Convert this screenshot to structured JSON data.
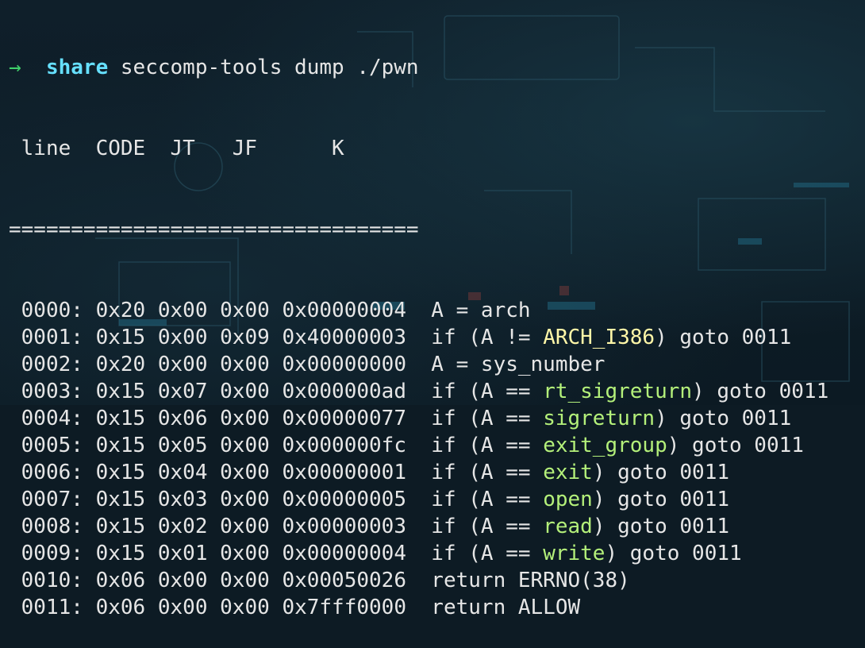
{
  "prompt": {
    "arrow": "→",
    "directory": "share",
    "command": "seccomp-tools dump ./pwn"
  },
  "header": {
    "text": " line  CODE  JT   JF      K"
  },
  "separator": "=================================",
  "rows": [
    {
      "line": "0000:",
      "code": "0x20",
      "jt": "0x00",
      "jf": "0x00",
      "k": "0x00000004",
      "pre": "A = arch",
      "name": "",
      "post": ""
    },
    {
      "line": "0001:",
      "code": "0x15",
      "jt": "0x00",
      "jf": "0x09",
      "k": "0x40000003",
      "pre": "if (A != ",
      "name": "ARCH_I386",
      "post": ") goto 0011",
      "name_kind": "arch"
    },
    {
      "line": "0002:",
      "code": "0x20",
      "jt": "0x00",
      "jf": "0x00",
      "k": "0x00000000",
      "pre": "A = sys_number",
      "name": "",
      "post": ""
    },
    {
      "line": "0003:",
      "code": "0x15",
      "jt": "0x07",
      "jf": "0x00",
      "k": "0x000000ad",
      "pre": "if (A == ",
      "name": "rt_sigreturn",
      "post": ") goto 0011"
    },
    {
      "line": "0004:",
      "code": "0x15",
      "jt": "0x06",
      "jf": "0x00",
      "k": "0x00000077",
      "pre": "if (A == ",
      "name": "sigreturn",
      "post": ") goto 0011"
    },
    {
      "line": "0005:",
      "code": "0x15",
      "jt": "0x05",
      "jf": "0x00",
      "k": "0x000000fc",
      "pre": "if (A == ",
      "name": "exit_group",
      "post": ") goto 0011"
    },
    {
      "line": "0006:",
      "code": "0x15",
      "jt": "0x04",
      "jf": "0x00",
      "k": "0x00000001",
      "pre": "if (A == ",
      "name": "exit",
      "post": ") goto 0011"
    },
    {
      "line": "0007:",
      "code": "0x15",
      "jt": "0x03",
      "jf": "0x00",
      "k": "0x00000005",
      "pre": "if (A == ",
      "name": "open",
      "post": ") goto 0011"
    },
    {
      "line": "0008:",
      "code": "0x15",
      "jt": "0x02",
      "jf": "0x00",
      "k": "0x00000003",
      "pre": "if (A == ",
      "name": "read",
      "post": ") goto 0011"
    },
    {
      "line": "0009:",
      "code": "0x15",
      "jt": "0x01",
      "jf": "0x00",
      "k": "0x00000004",
      "pre": "if (A == ",
      "name": "write",
      "post": ") goto 0011"
    },
    {
      "line": "0010:",
      "code": "0x06",
      "jt": "0x00",
      "jf": "0x00",
      "k": "0x00050026",
      "pre": "return ERRNO(38)",
      "name": "",
      "post": ""
    },
    {
      "line": "0011:",
      "code": "0x06",
      "jt": "0x00",
      "jf": "0x00",
      "k": "0x7fff0000",
      "pre": "return ALLOW",
      "name": "",
      "post": ""
    }
  ],
  "colors": {
    "background": "#0d1b24",
    "text": "#e6e6e6",
    "prompt_arrow": "#3fcf6a",
    "directory": "#66e0ff",
    "syscall_name": "#b4f07a",
    "arch_constant": "#fff7a8"
  }
}
